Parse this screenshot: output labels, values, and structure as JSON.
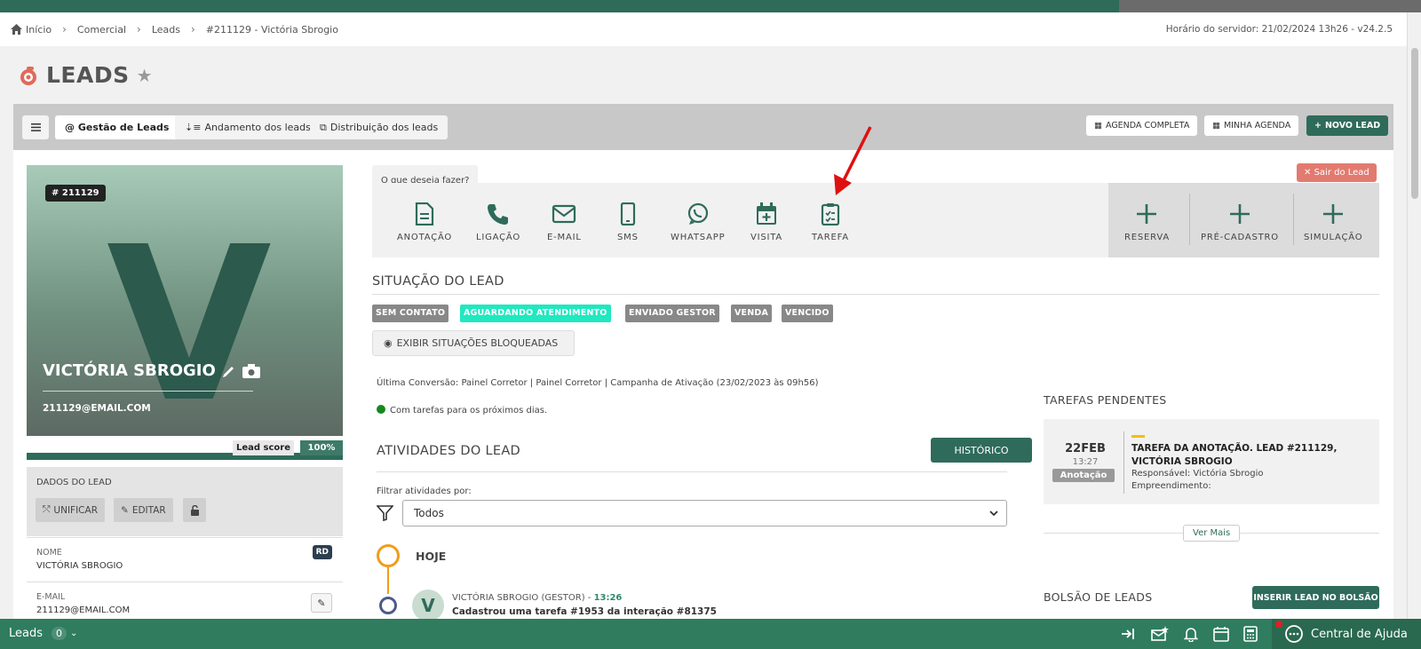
{
  "breadcrumb": [
    "Início",
    "Comercial",
    "Leads",
    "#211129 - Victória Sbrogio"
  ],
  "server_time": "Horário do servidor: 21/02/2024 13h26 - v24.2.5",
  "page_title": "LEADS",
  "tabs": {
    "menu_icon": "menu-icon",
    "gestao": "@ Gestão de Leads",
    "andamento": "Andamento dos leads",
    "distribuicao": "Distribuição dos leads"
  },
  "toolbar_right": {
    "agenda_completa": "AGENDA COMPLETA",
    "minha_agenda": "MINHA AGENDA",
    "novo_lead": "NOVO LEAD"
  },
  "lead": {
    "id_badge": "# 211129",
    "initial": "V",
    "name": "VICTÓRIA SBROGIO",
    "email": "211129@EMAIL.COM",
    "score_label": "Lead score",
    "score_value": "100%"
  },
  "dados": {
    "title": "DADOS DO LEAD",
    "unificar": "UNIFICAR",
    "editar": "EDITAR",
    "fields": [
      {
        "label": "NOME",
        "value": "VICTÓRIA SBROGIO",
        "badge": "RD"
      },
      {
        "label": "E-MAIL",
        "value": "211129@EMAIL.COM"
      }
    ]
  },
  "actions": {
    "prompt": "O que deseja fazer?",
    "items": [
      "ANOTAÇÃO",
      "LIGAÇÃO",
      "E-MAIL",
      "SMS",
      "WHATSAPP",
      "VISITA",
      "TAREFA"
    ],
    "secondary": [
      "RESERVA",
      "PRÉ-CADASTRO",
      "SIMULAÇÃO"
    ],
    "sair": "Sair do Lead"
  },
  "situacao": {
    "title": "SITUAÇÃO DO LEAD",
    "tags": [
      "SEM CONTATO",
      "AGUARDANDO ATENDIMENTO",
      "ENVIADO GESTOR",
      "VENDA",
      "VENCIDO"
    ],
    "active_tag": "AGUARDANDO ATENDIMENTO",
    "exibir": "EXIBIR SITUAÇÕES BLOQUEADAS"
  },
  "ultima_conversao": "Última Conversão: Painel Corretor | Painel Corretor | Campanha de Ativação (23/02/2023 às 09h56)",
  "tarefas_status": "Com tarefas para os próximos dias.",
  "atividades": {
    "title": "ATIVIDADES DO LEAD",
    "historico": "HISTÓRICO",
    "filter_label": "Filtrar atividades por:",
    "filter_value": "Todos",
    "hoje": "HOJE",
    "entry_author": "VICTÓRIA SBROGIO (GESTOR)",
    "entry_time": "13:26",
    "entry_initial": "V",
    "entry_text": "Cadastrou uma tarefa #1953 da interação #81375"
  },
  "tarefas": {
    "title": "TAREFAS PENDENTES",
    "date": "22FEB",
    "time": "13:27",
    "tag": "Anotação",
    "task_title": "TAREFA DA ANOTAÇÃO. LEAD #211129, VICTÓRIA SBROGIO",
    "responsavel": "Responsável: Victória Sbrogio",
    "empreendimento": "Empreendimento:",
    "ver_mais": "Ver Mais"
  },
  "bolsao": {
    "title": "BOLSÃO DE LEADS",
    "inserir": "INSERIR LEAD NO BOLSÃO"
  },
  "bottom": {
    "leads_label": "Leads",
    "leads_count": "0",
    "help": "Central de Ajuda"
  },
  "colors": {
    "brand_green": "#2f6b5a",
    "active_tag": "#20e8c0",
    "danger": "#e37a70",
    "annotation_arrow": "#e01010"
  }
}
